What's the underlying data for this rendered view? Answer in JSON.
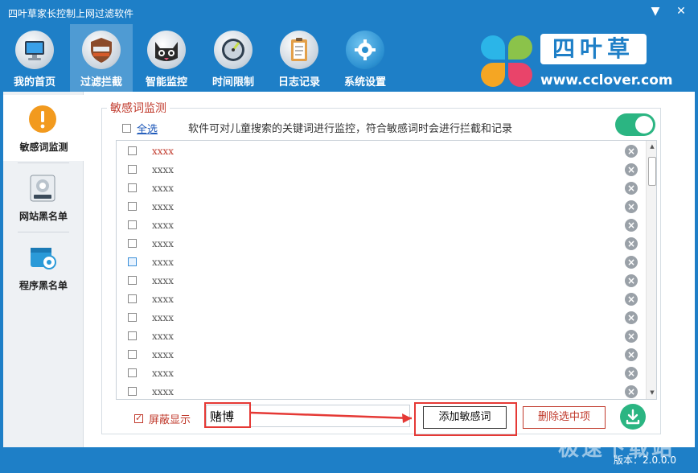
{
  "window": {
    "title": "四叶草家长控制上网过滤软件",
    "minimize_glyph": "▼",
    "close_glyph": "✕"
  },
  "toolbar": {
    "items": [
      {
        "label": "我的首页",
        "icon": "monitor-icon"
      },
      {
        "label": "过滤拦截",
        "icon": "shield-filter-icon",
        "active": true
      },
      {
        "label": "智能监控",
        "icon": "cat-monitor-icon"
      },
      {
        "label": "时间限制",
        "icon": "clock-icon"
      },
      {
        "label": "日志记录",
        "icon": "clipboard-icon"
      },
      {
        "label": "系统设置",
        "icon": "gear-icon"
      }
    ]
  },
  "logo": {
    "brand": "四叶草",
    "url": "www.cclover.com",
    "colors": [
      "#2bb5e8",
      "#8bc34a",
      "#f5a623",
      "#e9446a"
    ]
  },
  "sidebar": {
    "items": [
      {
        "label": "敏感词监测",
        "icon": "warning-icon",
        "active": true
      },
      {
        "label": "网站黑名单",
        "icon": "url-blacklist-icon"
      },
      {
        "label": "程序黑名单",
        "icon": "program-blacklist-icon"
      }
    ]
  },
  "section": {
    "legend": "敏感词监测",
    "select_all": "全选",
    "description": "软件可对儿童搜索的关键词进行监控，符合敏感词时会进行拦截和记录",
    "enabled": true
  },
  "words": [
    {
      "text": "xxxx",
      "highlight": true
    },
    {
      "text": "xxxx"
    },
    {
      "text": "xxxx"
    },
    {
      "text": "xxxx"
    },
    {
      "text": "xxxx"
    },
    {
      "text": "xxxx"
    },
    {
      "text": "xxxx",
      "hover": true
    },
    {
      "text": "xxxx"
    },
    {
      "text": "xxxx"
    },
    {
      "text": "xxxx"
    },
    {
      "text": "xxxx"
    },
    {
      "text": "xxxx"
    },
    {
      "text": "xxxx"
    },
    {
      "text": "xxxx"
    }
  ],
  "bottom": {
    "shield_display": "屏蔽显示",
    "shield_checked": true,
    "input_value": "赌博",
    "add_button": "添加敏感词",
    "delete_selected_button": "删除选中项"
  },
  "footer": {
    "watermark": "极速下载站",
    "version": "版本：2.0.0.0"
  },
  "colors": {
    "banner": "#1e7fc7",
    "accent_green": "#2bb582",
    "accent_red": "#c0392b",
    "annotation_red": "#e53935"
  }
}
